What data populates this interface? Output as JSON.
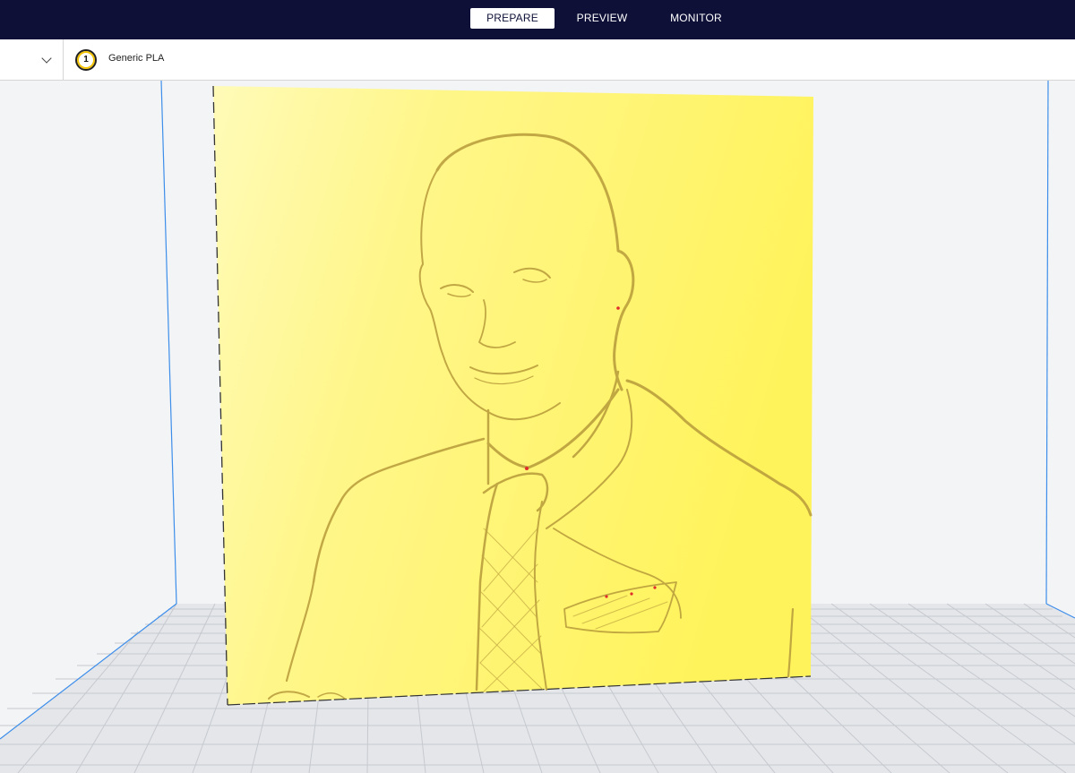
{
  "stages": {
    "prepare": "PREPARE",
    "preview": "PREVIEW",
    "monitor": "MONITOR"
  },
  "toolbar": {
    "extruder_number": "1",
    "material": "Generic PLA"
  },
  "colors": {
    "topbar": "#0e1037",
    "model": "#fff36a",
    "build_volume_edge": "#3d8eea"
  }
}
